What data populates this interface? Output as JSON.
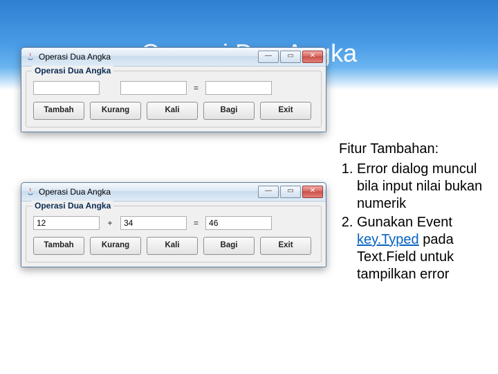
{
  "slide": {
    "title": "Operasi Dua Angka"
  },
  "windows": [
    {
      "title": "Operasi Dua Angka",
      "group_title": "Operasi Dua Angka",
      "input1": "",
      "operator": "",
      "input2": "",
      "equals": "=",
      "result": "",
      "buttons": [
        "Tambah",
        "Kurang",
        "Kali",
        "Bagi",
        "Exit"
      ]
    },
    {
      "title": "Operasi Dua Angka",
      "group_title": "Operasi Dua Angka",
      "input1": "12",
      "operator": "+",
      "input2": "34",
      "equals": "=",
      "result": "46",
      "buttons": [
        "Tambah",
        "Kurang",
        "Kali",
        "Bagi",
        "Exit"
      ]
    }
  ],
  "notes": {
    "heading": "Fitur Tambahan:",
    "items_html": [
      "Error dialog muncul bila input nilai bukan numerik",
      "Gunakan Event <span class=\"blue-link\">key.Typed</span> pada Text.Field untuk tampilkan error"
    ]
  }
}
